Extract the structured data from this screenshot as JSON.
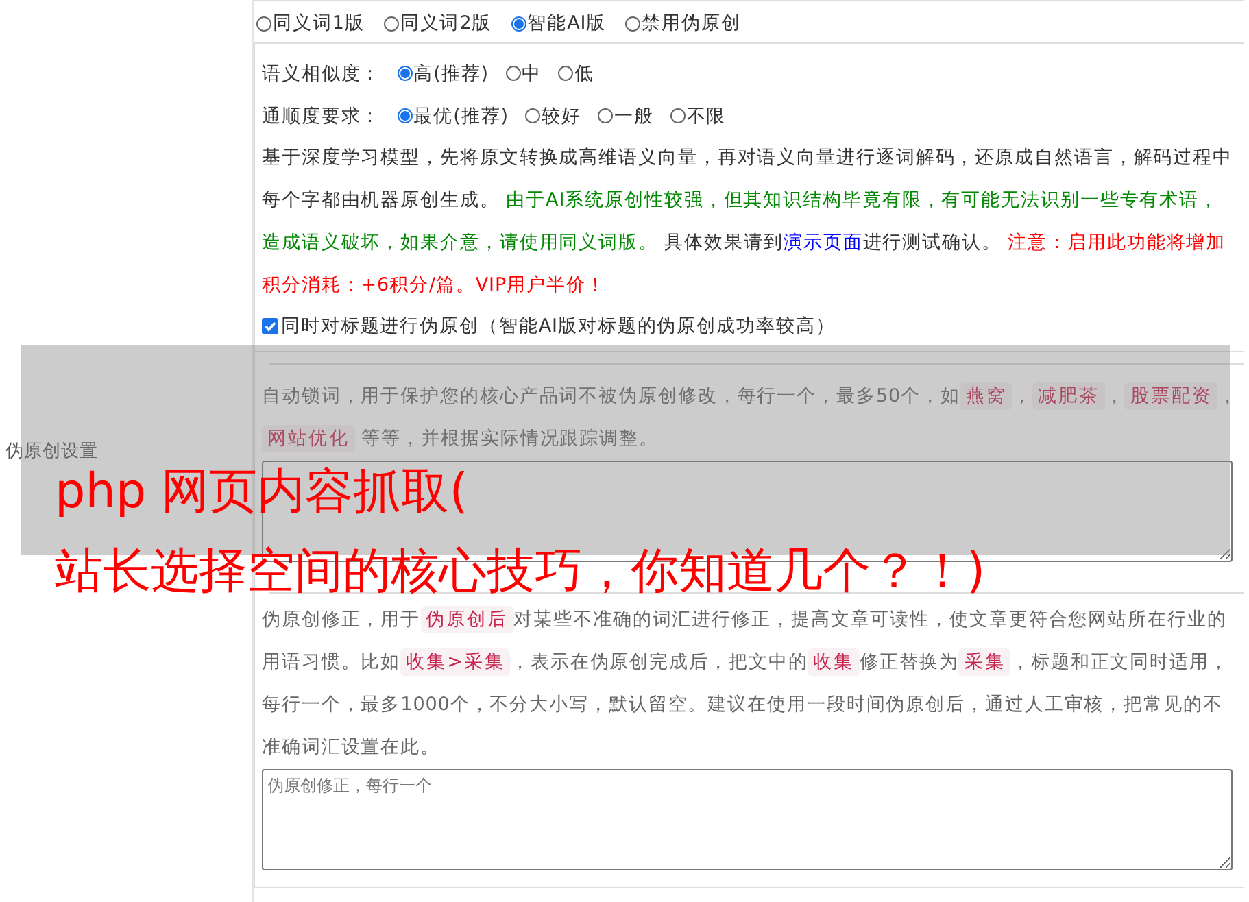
{
  "section_label": "伪原创设置",
  "mode_options": [
    {
      "label": "同义词1版",
      "selected": false
    },
    {
      "label": "同义词2版",
      "selected": false
    },
    {
      "label": "智能AI版",
      "selected": true
    },
    {
      "label": "禁用伪原创",
      "selected": false
    }
  ],
  "ai_panel": {
    "similarity": {
      "label": "语义相似度：",
      "options": [
        {
          "label": "高(推荐)",
          "selected": true
        },
        {
          "label": "中",
          "selected": false
        },
        {
          "label": "低",
          "selected": false
        }
      ]
    },
    "fluency": {
      "label": "通顺度要求：",
      "options": [
        {
          "label": "最优(推荐)",
          "selected": true
        },
        {
          "label": "较好",
          "selected": false
        },
        {
          "label": "一般",
          "selected": false
        },
        {
          "label": "不限",
          "selected": false
        }
      ]
    },
    "description": [
      {
        "kind": "text",
        "text": "基于深度学习模型，先将原文转换成高维语义向量，再对语义向量进行逐词解码，还原成自然语言，解码过程中每个字都由机器原创生成。 "
      },
      {
        "kind": "green",
        "text": "由于AI系统原创性较强，但其知识结构毕竟有限，有可能无法识别一些专有术语，造成语义破坏，如果介意，请使用同义词版。"
      },
      {
        "kind": "text",
        "text": " 具体效果请到"
      },
      {
        "kind": "link",
        "text": "演示页面"
      },
      {
        "kind": "text",
        "text": "进行测试确认。 "
      },
      {
        "kind": "red",
        "text": "注意：启用此功能将增加积分消耗：+6积分/篇。VIP用户半价！"
      }
    ]
  },
  "title_checkbox": {
    "label": "同时对标题进行伪原创（智能AI版对标题的伪原创成功率较高）",
    "checked": true
  },
  "lock_words": {
    "description": [
      {
        "kind": "text",
        "text": "自动锁词，用于保护您的核心产品词不被伪原创修改，每行一个，最多50个，如"
      },
      {
        "kind": "tag",
        "text": "燕窝"
      },
      {
        "kind": "text",
        "text": "，"
      },
      {
        "kind": "tag",
        "text": "减肥茶"
      },
      {
        "kind": "text",
        "text": "，"
      },
      {
        "kind": "tag",
        "text": "股票配资"
      },
      {
        "kind": "text",
        "text": "，"
      },
      {
        "kind": "tag",
        "text": "网站优化"
      },
      {
        "kind": "text",
        "text": " 等等，并根据实际情况跟踪调整。"
      }
    ]
  },
  "correction": {
    "description": [
      {
        "kind": "text",
        "text": "伪原创修正，用于"
      },
      {
        "kind": "tag",
        "text": "伪原创后"
      },
      {
        "kind": "text",
        "text": "对某些不准确的词汇进行修正，提高文章可读性，使文章更符合您网站所在行业的用语习惯。比如"
      },
      {
        "kind": "tag",
        "text": "收集>采集"
      },
      {
        "kind": "text",
        "text": "，表示在伪原创完成后，把文中的"
      },
      {
        "kind": "tag",
        "text": "收集"
      },
      {
        "kind": "text",
        "text": "修正替换为"
      },
      {
        "kind": "tag",
        "text": "采集"
      },
      {
        "kind": "text",
        "text": "，标题和正文同时适用，每行一个，最多1000个，不分大小写，默认留空。建议在使用一段时间伪原创后，通过人工审核，把常见的不准确词汇设置在此。"
      }
    ],
    "placeholder": "伪原创修正，每行一个"
  },
  "banner": {
    "lines": [
      "php 网页内容抓取(",
      "站长选择空间的核心技巧，你知道几个？！)"
    ]
  }
}
